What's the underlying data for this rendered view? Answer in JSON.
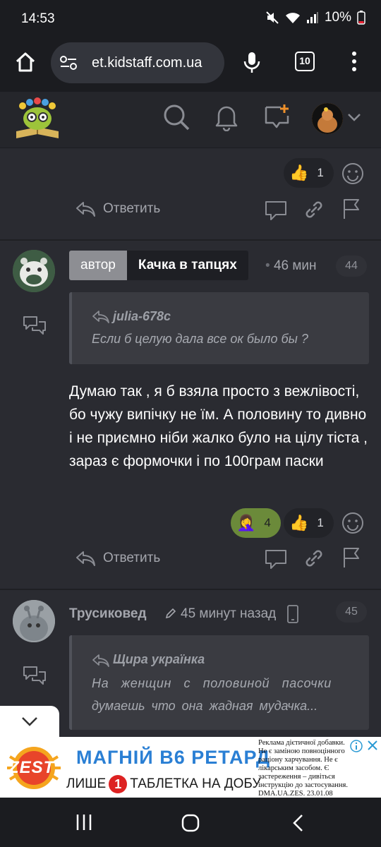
{
  "status_bar": {
    "time": "14:53",
    "battery": "10%"
  },
  "browser": {
    "url": "et.kidstaff.com.ua",
    "tab_count": "10"
  },
  "post1_footer": {
    "reaction": {
      "emoji": "👍",
      "count": "1"
    },
    "reply_label": "Ответить"
  },
  "post2": {
    "author_label": "автор",
    "author_name": "Качка в тапцях",
    "time": "46 мин",
    "number": "44",
    "quote": {
      "author": "julia-678c",
      "text": "Если б целую дала все ок было бы ?"
    },
    "body": "Думаю так , я б взяла просто з вежлівості, бо чужу випічку не їм. А половину то дивно і не приємно ніби жалко було на цілу тіста , зараз є формочки і по 100грам паски",
    "reactions": [
      {
        "emoji": "🤦‍♀️",
        "count": "4"
      },
      {
        "emoji": "👍",
        "count": "1"
      }
    ],
    "reply_label": "Ответить"
  },
  "post3": {
    "author_name": "Трусиковед",
    "time": "45 минут назад",
    "number": "45",
    "quote": {
      "author": "Щира українка",
      "text_line1": "На женщин с половиной пасочки",
      "text_line2": "думаешь что она жадная мудачка..."
    }
  },
  "ad": {
    "brand": "ZEST",
    "headline": "МАГНІЙ В6 РЕТАРД",
    "tagline_left": "ЛИШЕ",
    "tagline_number": "1",
    "tagline_right": "ТАБЛЕТКА НА ДОБУ",
    "disclaimer": "Реклама дієтичної добавки. Не є заміною повноцінного раціону харчування. Не є лікарським засобом. Є застереження – дивіться інструкцію до застосування. DMA.UA.ZES. 23.01.08"
  },
  "colors": {
    "page_bg": "#2a2b31",
    "header_bg": "#25262b",
    "accent_orange": "#f0902a",
    "reaction_active": "#6b8a3a",
    "ad_blue": "#2a7fd4"
  }
}
